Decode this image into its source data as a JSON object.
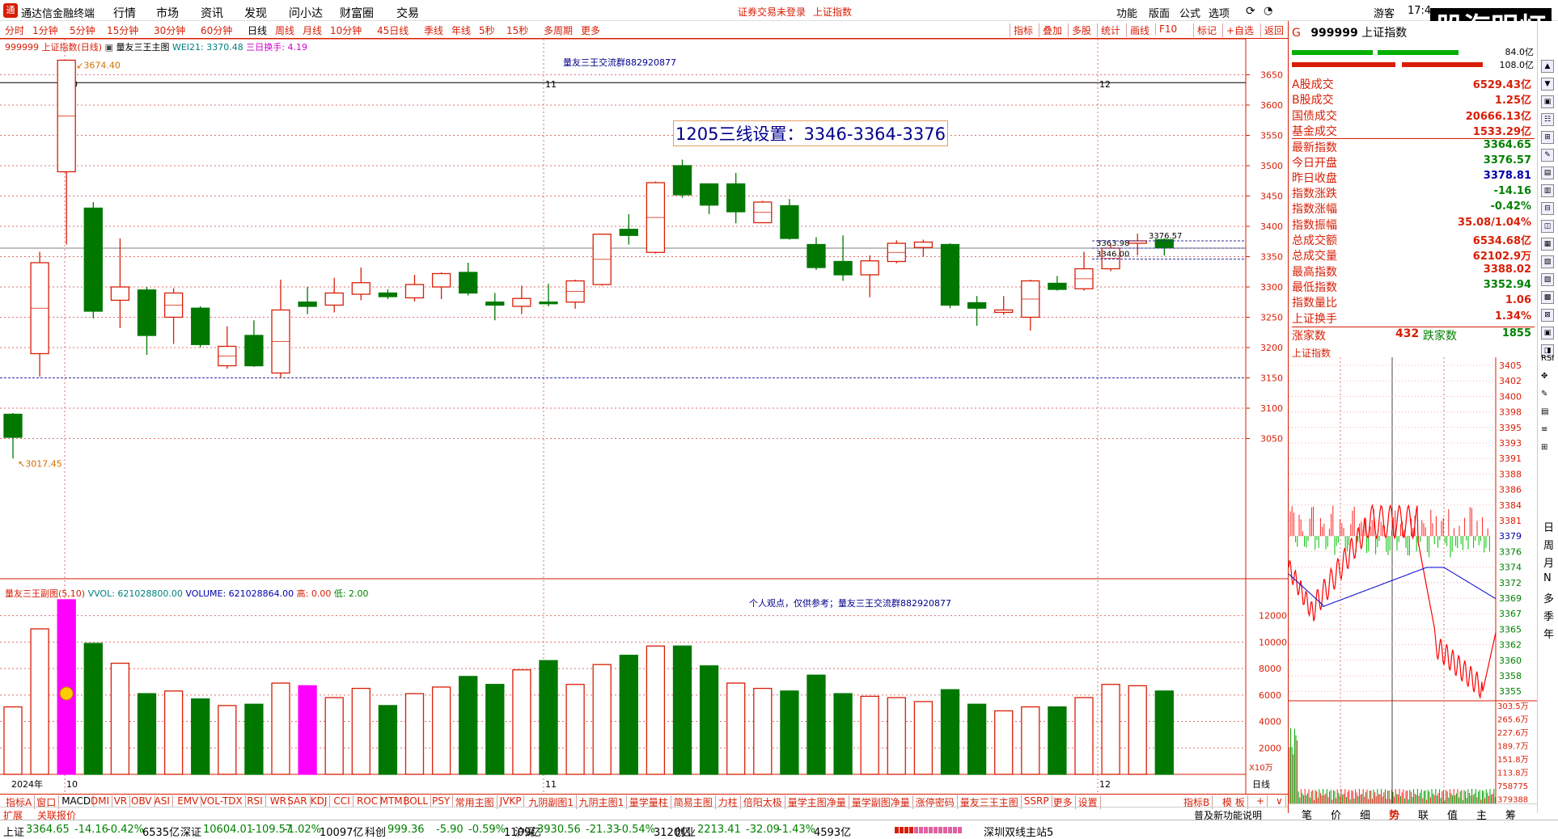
{
  "app": {
    "title": "通达信金融终端",
    "center_status": "证券交易未登录",
    "center_index": "上证指数",
    "clock": "17:4",
    "brand_badge": "股海明灯"
  },
  "menus": [
    "行情",
    "市场",
    "资讯",
    "发现",
    "问小达",
    "财富圈",
    "交易"
  ],
  "top_right": [
    "功能",
    "版面",
    "公式",
    "选项",
    "游客"
  ],
  "periods": [
    {
      "label": "分时"
    },
    {
      "label": "1分钟"
    },
    {
      "label": "5分钟"
    },
    {
      "label": "15分钟"
    },
    {
      "label": "30分钟"
    },
    {
      "label": "60分钟"
    },
    {
      "label": "日线",
      "selected": true
    },
    {
      "label": "周线"
    },
    {
      "label": "月线"
    },
    {
      "label": "10分钟"
    },
    {
      "label": "45日线"
    },
    {
      "label": "季线"
    },
    {
      "label": "年线"
    },
    {
      "label": "5秒"
    },
    {
      "label": "15秒"
    },
    {
      "label": "多周期"
    },
    {
      "label": "更多"
    }
  ],
  "right_tools": [
    "指标",
    "叠加",
    "多股",
    "统计",
    "画线",
    "F10",
    "标记",
    "+自选",
    "返回"
  ],
  "chart_header": {
    "code": "999999 上证指数(日线)",
    "indicator": "量友三王主图",
    "wei": "WEI21: 3370.48",
    "turnover": "三日换手: 4.19",
    "group_note": "量友三王交流群882920877",
    "setting_box": "1205三线设置：3346-3364-3376",
    "high_label": "3674.40",
    "low_label": "3017.45",
    "lv1": "3363.98",
    "lv2": "3376.57",
    "lv3": "3346.00",
    "month_labels": [
      "2024年",
      "10",
      "11",
      "12"
    ]
  },
  "vol_header": {
    "name": "量友三王副图(5,10)",
    "vvol": "VVOL: 621028800.00",
    "volume": "VOLUME: 621028864.00",
    "high": "高: 0.00",
    "low": "低: 2.00",
    "note": "个人观点，仅供参考；量友三王交流群882920877",
    "unit": "X10万",
    "axis_type": "日线"
  },
  "price_axis": [
    "3650",
    "3600",
    "3550",
    "3500",
    "3450",
    "3400",
    "3350",
    "3300",
    "3250",
    "3200",
    "3150",
    "3100",
    "3050"
  ],
  "vol_axis": [
    "12000",
    "10000",
    "8000",
    "6000",
    "4000",
    "2000"
  ],
  "chart_data": {
    "type": "candlestick",
    "title": "999999 上证指数(日线)",
    "ylim": [
      3000,
      3680
    ],
    "candles": [
      {
        "o": 3090,
        "c": 3052,
        "h": 3092,
        "l": 3017
      },
      {
        "o": 3190,
        "c": 3340,
        "h": 3358,
        "l": 3152
      },
      {
        "o": 3490,
        "c": 3674,
        "h": 3674,
        "l": 3370
      },
      {
        "o": 3430,
        "c": 3260,
        "h": 3440,
        "l": 3248
      },
      {
        "o": 3278,
        "c": 3300,
        "h": 3380,
        "l": 3232
      },
      {
        "o": 3295,
        "c": 3220,
        "h": 3300,
        "l": 3188
      },
      {
        "o": 3250,
        "c": 3290,
        "h": 3298,
        "l": 3206
      },
      {
        "o": 3265,
        "c": 3205,
        "h": 3268,
        "l": 3200
      },
      {
        "o": 3170,
        "c": 3202,
        "h": 3235,
        "l": 3165
      },
      {
        "o": 3220,
        "c": 3170,
        "h": 3245,
        "l": 3168
      },
      {
        "o": 3158,
        "c": 3262,
        "h": 3312,
        "l": 3150
      },
      {
        "o": 3275,
        "c": 3268,
        "h": 3300,
        "l": 3255
      },
      {
        "o": 3270,
        "c": 3290,
        "h": 3315,
        "l": 3258
      },
      {
        "o": 3288,
        "c": 3307,
        "h": 3332,
        "l": 3278
      },
      {
        "o": 3290,
        "c": 3284,
        "h": 3296,
        "l": 3280
      },
      {
        "o": 3282,
        "c": 3304,
        "h": 3320,
        "l": 3276
      },
      {
        "o": 3300,
        "c": 3322,
        "h": 3324,
        "l": 3280
      },
      {
        "o": 3324,
        "c": 3290,
        "h": 3340,
        "l": 3286
      },
      {
        "o": 3275,
        "c": 3270,
        "h": 3290,
        "l": 3245
      },
      {
        "o": 3268,
        "c": 3281,
        "h": 3302,
        "l": 3255
      },
      {
        "o": 3275,
        "c": 3273,
        "h": 3305,
        "l": 3268
      },
      {
        "o": 3275,
        "c": 3310,
        "h": 3312,
        "l": 3264
      },
      {
        "o": 3304,
        "c": 3387,
        "h": 3388,
        "l": 3302
      },
      {
        "o": 3395,
        "c": 3385,
        "h": 3420,
        "l": 3370
      },
      {
        "o": 3357,
        "c": 3472,
        "h": 3474,
        "l": 3355
      },
      {
        "o": 3500,
        "c": 3452,
        "h": 3510,
        "l": 3447
      },
      {
        "o": 3470,
        "c": 3435,
        "h": 3471,
        "l": 3420
      },
      {
        "o": 3470,
        "c": 3424,
        "h": 3488,
        "l": 3405
      },
      {
        "o": 3406,
        "c": 3440,
        "h": 3442,
        "l": 3405
      },
      {
        "o": 3434,
        "c": 3380,
        "h": 3445,
        "l": 3378
      },
      {
        "o": 3370,
        "c": 3332,
        "h": 3382,
        "l": 3328
      },
      {
        "o": 3342,
        "c": 3320,
        "h": 3385,
        "l": 3310
      },
      {
        "o": 3320,
        "c": 3343,
        "h": 3352,
        "l": 3283
      },
      {
        "o": 3342,
        "c": 3372,
        "h": 3377,
        "l": 3339
      },
      {
        "o": 3365,
        "c": 3374,
        "h": 3378,
        "l": 3350
      },
      {
        "o": 3370,
        "c": 3270,
        "h": 3372,
        "l": 3265
      },
      {
        "o": 3274,
        "c": 3265,
        "h": 3285,
        "l": 3236
      },
      {
        "o": 3258,
        "c": 3262,
        "h": 3285,
        "l": 3254
      },
      {
        "o": 3250,
        "c": 3310,
        "h": 3312,
        "l": 3228
      },
      {
        "o": 3306,
        "c": 3296,
        "h": 3318,
        "l": 3294
      },
      {
        "o": 3297,
        "c": 3330,
        "h": 3358,
        "l": 3294
      },
      {
        "o": 3330,
        "c": 3364,
        "h": 3370,
        "l": 3326
      },
      {
        "o": 3372,
        "c": 3376,
        "h": 3388,
        "l": 3352
      },
      {
        "o": 3378,
        "c": 3365,
        "h": 3380,
        "l": 3352
      }
    ],
    "volume": [
      5100,
      11000,
      13200,
      9900,
      8400,
      6100,
      6300,
      5700,
      5200,
      5300,
      6900,
      6700,
      5800,
      6500,
      5200,
      6100,
      6600,
      7400,
      6800,
      7900,
      8600,
      6800,
      8300,
      9000,
      9700,
      9700,
      8200,
      6900,
      6500,
      6300,
      7500,
      6100,
      5900,
      5800,
      5500,
      6400,
      5300,
      4800,
      5100,
      5100,
      5800,
      6800,
      6700,
      6300
    ],
    "vol_colors": [
      "w",
      "w",
      "m",
      "g",
      "w",
      "g",
      "w",
      "g",
      "w",
      "g",
      "w",
      "m",
      "w",
      "w",
      "g",
      "w",
      "w",
      "g",
      "g",
      "w",
      "g",
      "w",
      "w",
      "g",
      "w",
      "g",
      "g",
      "w",
      "w",
      "g",
      "g",
      "g",
      "w",
      "w",
      "w",
      "g",
      "g",
      "w",
      "w",
      "g",
      "w",
      "w",
      "w",
      "g"
    ]
  },
  "quote_panel": {
    "code": "999999",
    "name": "上证指数",
    "rows": [
      {
        "k": "A股成交",
        "v": "6529.43亿",
        "c": "#d81e06"
      },
      {
        "k": "B股成交",
        "v": "1.25亿",
        "c": "#d81e06"
      },
      {
        "k": "国债成交",
        "v": "20666.13亿",
        "c": "#d81e06"
      },
      {
        "k": "基金成交",
        "v": "1533.29亿",
        "c": "#d81e06"
      },
      {
        "k": "最新指数",
        "v": "3364.65",
        "c": "#008000"
      },
      {
        "k": "今日开盘",
        "v": "3376.57",
        "c": "#008000"
      },
      {
        "k": "昨日收盘",
        "v": "3378.81",
        "c": "#0000aa"
      },
      {
        "k": "指数涨跌",
        "v": "-14.16",
        "c": "#008000"
      },
      {
        "k": "指数涨幅",
        "v": "-0.42%",
        "c": "#008000"
      },
      {
        "k": "指数振幅",
        "v": "35.08/1.04%",
        "c": "#d81e06"
      },
      {
        "k": "总成交额",
        "v": "6534.68亿",
        "c": "#d81e06"
      },
      {
        "k": "总成交量",
        "v": "62102.9万",
        "c": "#d81e06"
      },
      {
        "k": "最高指数",
        "v": "3388.02",
        "c": "#d81e06"
      },
      {
        "k": "最低指数",
        "v": "3352.94",
        "c": "#008000"
      },
      {
        "k": "指数量比",
        "v": "1.06",
        "c": "#d81e06"
      },
      {
        "k": "上证换手",
        "v": "1.34%",
        "c": "#d81e06"
      }
    ],
    "top_values": [
      "84.0亿",
      "108.0亿"
    ],
    "up_label": "涨家数",
    "up_count": "432",
    "down_label": "跌家数",
    "down_count": "1855",
    "mini_title": "上证指数",
    "mini_axis": [
      "3405",
      "3402",
      "3400",
      "3398",
      "3395",
      "3393",
      "3391",
      "3388",
      "3386",
      "3384",
      "3381",
      "3379",
      "3376",
      "3374",
      "3372",
      "3369",
      "3367",
      "3365",
      "3362",
      "3360",
      "3358",
      "3355"
    ],
    "mini_vol_axis": [
      "303.5万",
      "265.6万",
      "227.6万",
      "189.7万",
      "151.8万",
      "113.8万",
      "758775",
      "379388"
    ],
    "bottom_tabs": [
      "笔",
      "价",
      "细",
      "势",
      "联",
      "值",
      "主",
      "筹"
    ]
  },
  "sidebar_text": [
    "日",
    "周",
    "月",
    "N",
    "多",
    "季",
    "年"
  ],
  "indicators": [
    "指标A",
    "窗口",
    "MACD",
    "DMI",
    "VR",
    "OBV",
    "ASI",
    "EMV",
    "VOL-TDX",
    "RSI",
    "WR",
    "SAR",
    "KDJ",
    "CCI",
    "ROC",
    "MTM",
    "BOLL",
    "PSY",
    "常用主图",
    "JVKP",
    "九阴副图1",
    "九阴主图1",
    "量学量柱",
    "简易主图",
    "力柱",
    "倍阳太极",
    "量学主图净量",
    "量学副图净量",
    "涨停密码",
    "量友三王主图",
    "SSRP",
    "更多",
    "设置"
  ],
  "indicator_right": [
    "指标B",
    "模 板",
    "+",
    "∨"
  ],
  "ext_left": [
    "扩展",
    "关联报价"
  ],
  "ext_right": "普及新功能说明",
  "status": {
    "sh": {
      "label": "上证",
      "price": "3364.65",
      "chg": "-14.16",
      "pct": "-0.42%",
      "amt": "6535亿"
    },
    "sz": {
      "label": "深证",
      "price": "10604.01",
      "chg": "-109.57",
      "pct": "-1.02%",
      "amt": "10097亿"
    },
    "kc": {
      "label": "科创",
      "price": "999.36",
      "chg": "-5.90",
      "pct": "-0.59%",
      "amt": "1109亿"
    },
    "hs": {
      "label": "沪深",
      "price": "3930.56",
      "chg": "-21.33",
      "pct": "-0.54%",
      "amt": "3120亿"
    },
    "cy": {
      "label": "创业",
      "price": "2213.41",
      "chg": "-32.09",
      "pct": "-1.43%",
      "amt": "4593亿"
    },
    "server": "深圳双线主站5"
  }
}
